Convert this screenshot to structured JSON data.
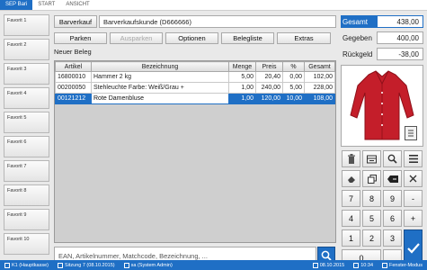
{
  "ribbon": {
    "tabs": [
      "SEP Bari",
      "START",
      "ANSICHT"
    ]
  },
  "favorites": [
    "Favorit 1",
    "Favorit 2",
    "Favorit 3",
    "Favorit 4",
    "Favorit 5",
    "Favorit 6",
    "Favorit 7",
    "Favorit 8",
    "Favorit 9",
    "Favorit 10"
  ],
  "customer": {
    "type_label": "Barverkauf",
    "name": "Barverkaufskunde (D666666)"
  },
  "toolbar": {
    "parken": "Parken",
    "ausparken": "Ausparken",
    "optionen": "Optionen",
    "belegliste": "Belegliste",
    "extras": "Extras"
  },
  "beleg_label": "Neuer Beleg",
  "grid": {
    "columns": [
      "Artikel",
      "Bezeichnung",
      "Menge",
      "Preis",
      "%",
      "Gesamt"
    ],
    "rows": [
      [
        "16800010",
        "Hammer 2 kg",
        "5,00",
        "20,40",
        "0,00",
        "102,00"
      ],
      [
        "00200050",
        "Stehleuchte Farbe: Weiß/Grau +",
        "1,00",
        "240,00",
        "5,00",
        "228,00"
      ],
      [
        "00121212",
        "Rote Damenbluse",
        "1,00",
        "120,00",
        "10,00",
        "108,00"
      ]
    ]
  },
  "search": {
    "placeholder": "EAN, Artikelnummer, Matchcode, Bezeichnung, ..."
  },
  "totals": {
    "gesamt_label": "Gesamt",
    "gesamt_value": "438,00",
    "gegeben_label": "Gegeben",
    "gegeben_value": "400,00",
    "rueckgeld_label": "Rückgeld",
    "rueckgeld_value": "-38,00"
  },
  "keypad": {
    "digits": [
      "7",
      "8",
      "9",
      "4",
      "5",
      "6",
      "1",
      "2",
      "3",
      "0",
      ","
    ],
    "ops": [
      "-",
      "+"
    ]
  },
  "status": {
    "station": "K1 (Hauptkasse)",
    "session": "Sitzung 7 (08.10.2015)",
    "user": "sa (System Admin)",
    "date": "08.10.2015",
    "time": "10:34",
    "mode": "Fenster-Modus"
  },
  "colors": {
    "accent": "#1f6fc5",
    "product": "#c41e2a"
  }
}
